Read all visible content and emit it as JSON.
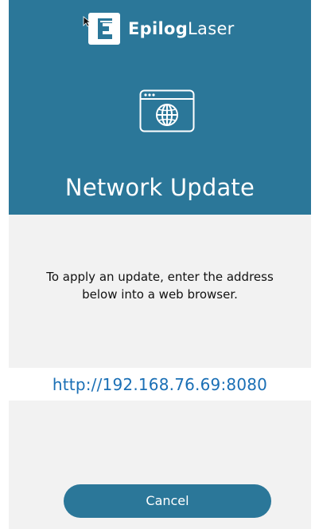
{
  "header": {
    "logo": {
      "brand_bold": "Epilog",
      "brand_light": "Laser"
    },
    "icon": "browser-globe-icon",
    "title": "Network Update"
  },
  "main": {
    "instructions": "To apply an update, enter the address below into a web browser.",
    "address": "http://192.168.76.69:8080"
  },
  "footer": {
    "cancel_label": "Cancel"
  },
  "colors": {
    "header_bg": "#2b7799",
    "body_bg": "#f2f2f2",
    "address_text": "#1a6fb5",
    "button_bg": "#2b7799"
  }
}
